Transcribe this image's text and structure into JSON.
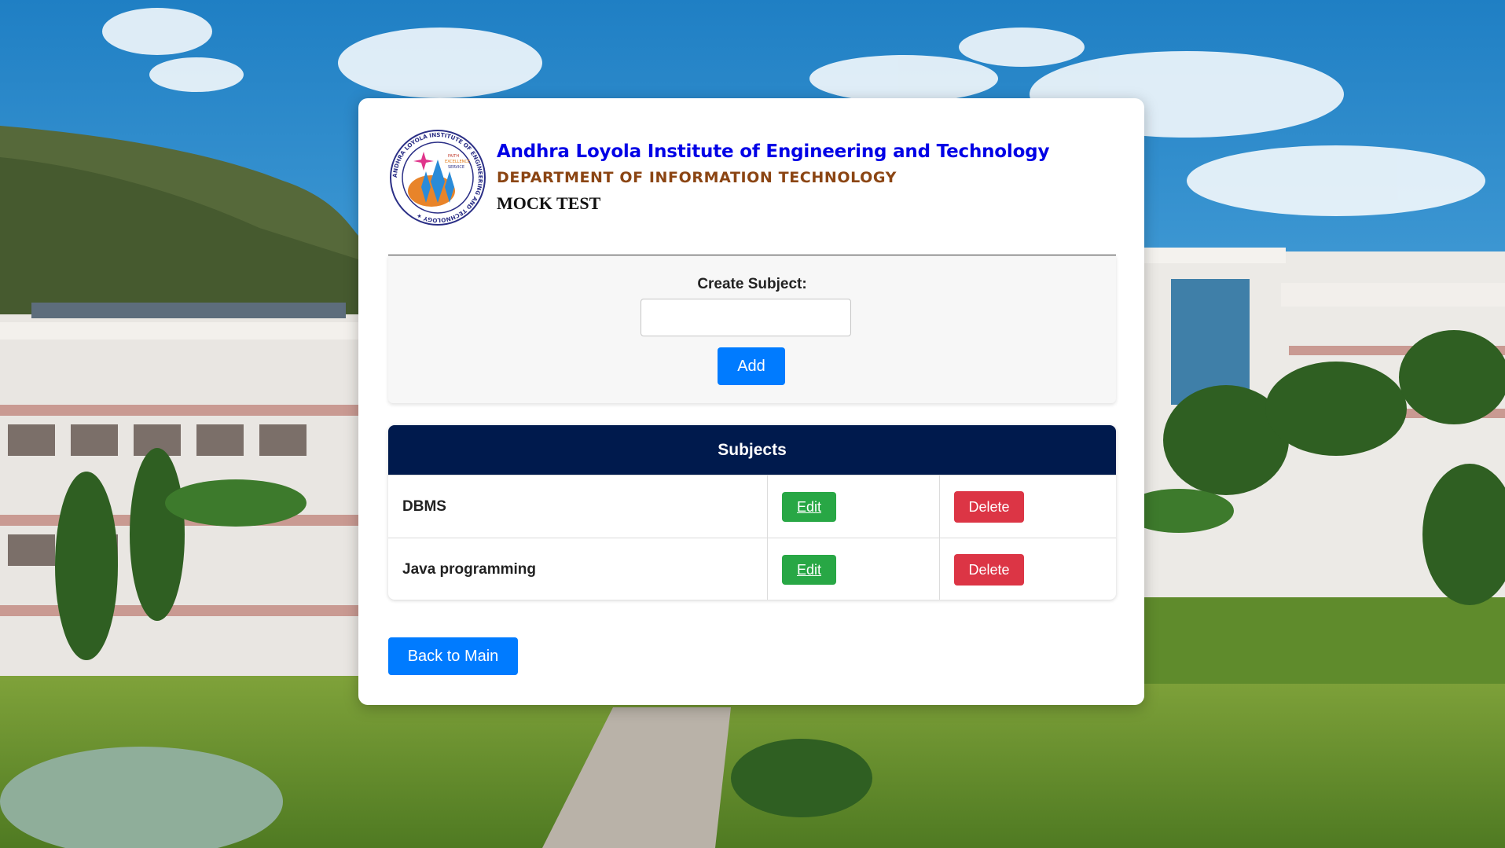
{
  "header": {
    "institution": "Andhra Loyola Institute of Engineering and Technology",
    "department": "DEPARTMENT OF INFORMATION TECHNOLOGY",
    "page_title": "MOCK TEST",
    "logo_text": "ANDHRA LOYOLA INSTITUTE OF ENGINEERING AND TECHNOLOGY",
    "logo_motto": [
      "FAITH",
      "EXCELLENCE",
      "SERVICE"
    ]
  },
  "create": {
    "label": "Create Subject:",
    "input_value": "",
    "input_placeholder": "",
    "add_label": "Add"
  },
  "subjects": {
    "heading": "Subjects",
    "rows": [
      {
        "name": "DBMS",
        "edit_label": "Edit",
        "delete_label": "Delete"
      },
      {
        "name": "Java programming",
        "edit_label": "Edit",
        "delete_label": "Delete"
      }
    ]
  },
  "footer": {
    "back_label": "Back to Main"
  },
  "colors": {
    "primary": "#007bff",
    "success": "#28a745",
    "danger": "#dc3545",
    "table_header": "#001a4d",
    "institution_text": "#0000e6",
    "department_text": "#8b4513"
  }
}
